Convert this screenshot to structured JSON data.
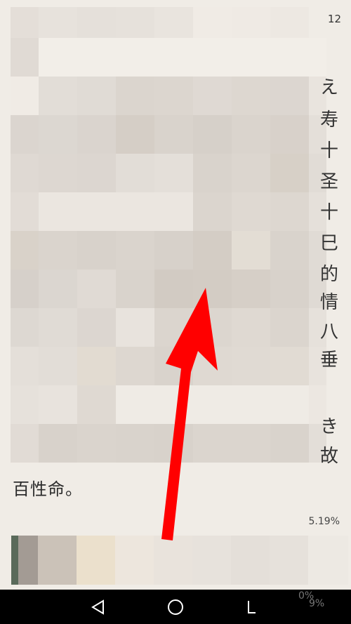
{
  "reader": {
    "page_indicator": "12",
    "side_chars": [
      "え",
      "寿",
      "十",
      "圣",
      "十",
      "巳",
      "的",
      "情",
      "八",
      "垂",
      "き",
      "故"
    ],
    "body_text": "百性命。",
    "progress_text": "5.19%",
    "ghost_percent_a": "0%",
    "ghost_percent_b": "9%"
  },
  "navbar": {
    "back_icon": "triangle-back-icon",
    "home_icon": "circle-home-icon",
    "recents_icon": "bracket-recents-icon"
  },
  "colors": {
    "page_bg": "#f0ece6",
    "arrow": "#ff0000",
    "navbar_bg": "#000000",
    "nav_icon": "#ffffff"
  }
}
